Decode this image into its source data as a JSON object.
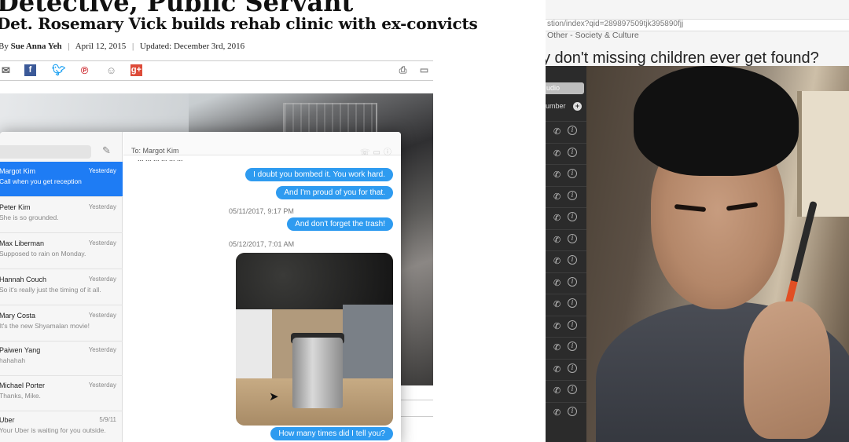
{
  "article": {
    "title": "Detective, Public Servant",
    "subtitle": "Det. Rosemary Vick builds rehab clinic with ex-convicts",
    "byline": {
      "prefix": "By",
      "author": "Sue Anna Yeh",
      "date": "April 12, 2015",
      "updated": "Updated: December 3rd, 2016"
    },
    "share_icons": [
      "email-icon",
      "facebook-icon",
      "twitter-icon",
      "pinterest-icon",
      "reddit-icon",
      "google-plus-icon",
      "print-icon",
      "comment-icon"
    ]
  },
  "messages": {
    "search_placeholder": "",
    "conversations": [
      {
        "name": "Margot Kim",
        "date": "Yesterday",
        "preview": "Call when you get reception",
        "selected": true
      },
      {
        "name": "Peter Kim",
        "date": "Yesterday",
        "preview": "She is so grounded."
      },
      {
        "name": "Max Liberman",
        "date": "Yesterday",
        "preview": "Supposed to rain on Monday."
      },
      {
        "name": "Hannah Couch",
        "date": "Yesterday",
        "preview": "So it's really just the timing of it all."
      },
      {
        "name": "Mary Costa",
        "date": "Yesterday",
        "preview": "It's the new Shyamalan movie!"
      },
      {
        "name": "Paiwen Yang",
        "date": "Yesterday",
        "preview": "hahahah"
      },
      {
        "name": "Michael Porter",
        "date": "Yesterday",
        "preview": "Thanks, Mike."
      },
      {
        "name": "Uber",
        "date": "5/9/11",
        "preview": "Your Uber is waiting for you outside."
      }
    ],
    "chat": {
      "to_label": "To: Margot Kim",
      "cut_text": "... ... ... ... ... ...",
      "bubbles": {
        "b1": "I doubt you bombed it. You work hard.",
        "b2": "And I'm proud of you for that.",
        "b3": "And don't forget the trash!",
        "b4": "How many times did I tell you?"
      },
      "stamps": {
        "s1": "05/11/2017, 9:17 PM",
        "s2": "05/12/2017, 7:01 AM"
      }
    }
  },
  "browser": {
    "url": "stion/index?qid=289897509tjk395890fjj",
    "category": "Other - Society & Culture",
    "question": "y don't missing children ever get found?",
    "panel": {
      "audio_label": "udio",
      "number_label": "umber",
      "call_rows": 14
    }
  },
  "colors": {
    "imessage_blue": "#2e9bf0",
    "selected_row": "#1e7cf4",
    "facebook": "#3b5998",
    "google_plus": "#dd4b39"
  }
}
